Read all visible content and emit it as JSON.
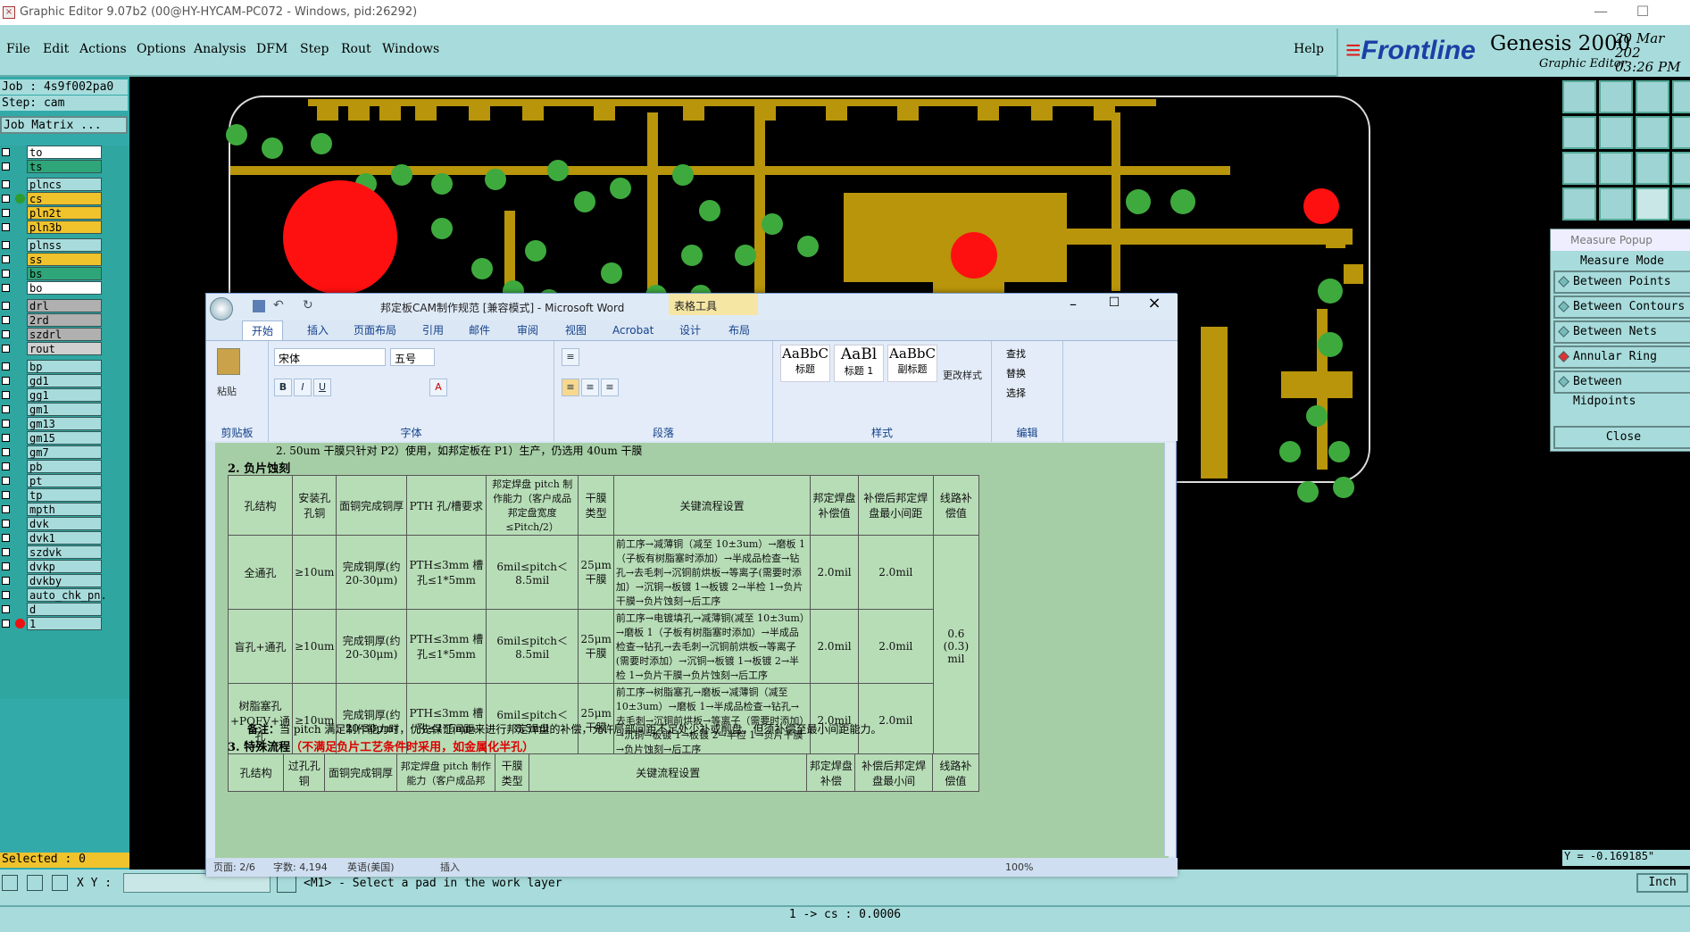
{
  "app": {
    "title": "Graphic Editor 9.07b2 (00@HY-HYCAM-PC072 - Windows, pid:26292)"
  },
  "menu": [
    "File",
    "Edit",
    "Actions",
    "Options",
    "Analysis",
    "DFM",
    "Step",
    "Rout",
    "Windows"
  ],
  "help": "Help",
  "brand": {
    "logo": "Frontline",
    "product": "Genesis 2000",
    "sub": "Graphic Editor",
    "date": "20 Mar 202",
    "time": "03:26 PM"
  },
  "job": {
    "job": "Job : 4s9f002pa0",
    "step": "Step: cam",
    "matrix": "Job Matrix ..."
  },
  "layers": [
    {
      "name": "to",
      "color": "#ffffff"
    },
    {
      "name": "ts",
      "color": "#2fa67a"
    },
    {
      "name": "plncs",
      "color": "#a8dcdc"
    },
    {
      "name": "cs",
      "color": "#f0c22c",
      "dot": "#2e9b2e"
    },
    {
      "name": "pln2t",
      "color": "#f0c22c"
    },
    {
      "name": "pln3b",
      "color": "#f0c22c"
    },
    {
      "name": "plnss",
      "color": "#a8dcdc"
    },
    {
      "name": "ss",
      "color": "#f0c22c"
    },
    {
      "name": "bs",
      "color": "#2fa67a"
    },
    {
      "name": "bo",
      "color": "#ffffff"
    },
    {
      "name": "drl",
      "color": "#b0b0b0"
    },
    {
      "name": "2rd",
      "color": "#b0b0b0"
    },
    {
      "name": "szdrl",
      "color": "#b0b0b0"
    },
    {
      "name": "rout",
      "color": "#d0d0d0"
    },
    {
      "name": "bp",
      "color": "#a8dcdc"
    },
    {
      "name": "gd1",
      "color": "#a8dcdc"
    },
    {
      "name": "gg1",
      "color": "#a8dcdc"
    },
    {
      "name": "gm1",
      "color": "#a8dcdc"
    },
    {
      "name": "gm13",
      "color": "#a8dcdc"
    },
    {
      "name": "gm15",
      "color": "#a8dcdc"
    },
    {
      "name": "gm7",
      "color": "#a8dcdc"
    },
    {
      "name": "pb",
      "color": "#a8dcdc"
    },
    {
      "name": "pt",
      "color": "#a8dcdc"
    },
    {
      "name": "tp",
      "color": "#a8dcdc"
    },
    {
      "name": "mpth",
      "color": "#a8dcdc"
    },
    {
      "name": "dvk",
      "color": "#a8dcdc"
    },
    {
      "name": "dvk1",
      "color": "#a8dcdc"
    },
    {
      "name": "szdvk",
      "color": "#a8dcdc"
    },
    {
      "name": "dvkp",
      "color": "#a8dcdc"
    },
    {
      "name": "dvkby",
      "color": "#a8dcdc"
    },
    {
      "name": "auto_chk_pn.",
      "color": "#a8dcdc"
    },
    {
      "name": "d",
      "color": "#a8dcdc"
    },
    {
      "name": "1",
      "color": "#a8dcdc",
      "dot": "#e11"
    }
  ],
  "selected": "Selected : 0",
  "xy": {
    "label": "X Y :",
    "prompt": "<M1> - Select a pad in the work layer",
    "unit": "Inch"
  },
  "status": "1 -> cs : 0.0006",
  "measure": {
    "title": "Measure Popup",
    "mode": "Measure Mode",
    "options": [
      "Between Points",
      "Between Contours",
      "Between Nets",
      "Annular Ring",
      "Between Midpoints"
    ],
    "close": "Close",
    "y": "Y = -0.169185\""
  },
  "word": {
    "title": "邦定板CAM制作规范 [兼容模式] - Microsoft Word",
    "context_tab": "表格工具",
    "tabs": [
      "开始",
      "插入",
      "页面布局",
      "引用",
      "邮件",
      "审阅",
      "视图",
      "Acrobat",
      "设计",
      "布局"
    ],
    "font": "宋体",
    "size": "五号",
    "groups": [
      "剪贴板",
      "字体",
      "段落",
      "样式",
      "编辑"
    ],
    "styles": [
      {
        "sample": "AaBbC",
        "name": "标题"
      },
      {
        "sample": "AaBl",
        "name": "标题 1"
      },
      {
        "sample": "AaBbC",
        "name": "副标题"
      }
    ],
    "change_style": "更改样式",
    "edit": [
      "查找",
      "替换",
      "选择"
    ],
    "paste": "粘贴",
    "status": {
      "page": "页面: 2/6",
      "words": "字数: 4,194",
      "lang": "英语(美国)",
      "mode": "插入",
      "zoom": "100%"
    }
  },
  "doc": {
    "topline": "2. 50um 干膜只针对 P2）使用，如邦定板在 P1）生产，仍选用 40um 干膜",
    "h2": "2. 负片蚀刻",
    "headers": [
      "孔结构",
      "安装孔孔铜",
      "面铜完成铜厚",
      "PTH 孔/槽要求",
      "邦定焊盘 pitch 制作能力（客户成品邦定盘宽度≤Pitch/2）",
      "干膜类型",
      "关键流程设置",
      "邦定焊盘补偿值",
      "补偿后邦定焊盘最小间距",
      "线路补偿值"
    ],
    "rows": [
      {
        "c0": "全通孔",
        "c1": "≥10um",
        "c2": "完成铜厚(约 20-30μm)",
        "c3": "PTH≤3mm 槽孔≤1*5mm",
        "c4": "6mil≤pitch＜8.5mil",
        "c5": "25μm 干膜",
        "c6": "前工序→减薄铜（减至 10±3um）→磨板 1（子板有树脂塞时添加）→半成品检查→钻孔→去毛刺→沉铜前烘板→等离子(需要时添加）→沉铜→板镀 1→板镀 2→半检 1→负片干膜→负片蚀刻→后工序",
        "c7": "2.0mil",
        "c8": "2.0mil"
      },
      {
        "c0": "盲孔+通孔",
        "c1": "≥10um",
        "c2": "完成铜厚(约 20-30μm)",
        "c3": "PTH≤3mm 槽孔≤1*5mm",
        "c4": "6mil≤pitch＜8.5mil",
        "c5": "25μm 干膜",
        "c6": "前工序→电镀填孔→减薄铜(减至 10±3um）→磨板 1（子板有树脂塞时添加）→半成品检查→钻孔→去毛刺→沉铜前烘板→等离子(需要时添加）→沉铜→板镀 1→板镀 2→半检 1→负片干膜→负片蚀刻→后工序",
        "c7": "2.0mil",
        "c8": "2.0mil"
      },
      {
        "c0": "树脂塞孔+POFV+通孔",
        "c1": "≥10um",
        "c2": "完成铜厚(约 20-30μm)",
        "c3": "PTH≤3mm 槽孔≤1*5mm",
        "c4": "6mil≤pitch＜8.5mil",
        "c5": "25μm 干膜",
        "c6": "前工序→树脂塞孔→磨板→减薄铜（减至 10±3um）→磨板 1→半成品检查→钻孔→去毛刺→沉铜前烘板→等离子（需要时添加）→沉铜→板镀 1→板镀 2→半检 1→负片干膜→负片蚀刻→后工序",
        "c7": "2.0mil",
        "c8": "2.0mil"
      }
    ],
    "line_comp": "0.6 (0.3) mil",
    "note_label": "备注：",
    "note": "当 pitch 满足制作能力时，优先保证间距来进行邦定焊盘的补偿，允许局部间距不足处少补或削盘，但须补偿至最小间距能力。",
    "h3": "3. 特殊流程",
    "h3_red": "（不满足负片工艺条件时采用，如金属化半孔）",
    "headers2": [
      "孔结构",
      "过孔孔铜",
      "面铜完成铜厚",
      "邦定焊盘 pitch 制作能力（客户成品邦",
      "干膜类型",
      "关键流程设置",
      "邦定焊盘补偿",
      "补偿后邦定焊盘最小间",
      "线路补偿值"
    ]
  }
}
